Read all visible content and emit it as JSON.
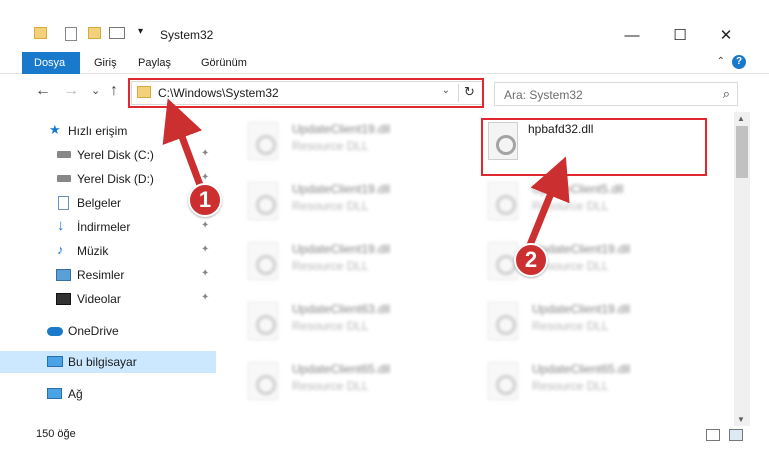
{
  "window": {
    "title": "System32",
    "minimize": "—",
    "maximize": "☐",
    "close": "✕"
  },
  "ribbon": {
    "tabs": [
      "Dosya",
      "Giriş",
      "Paylaş",
      "Görünüm"
    ],
    "help": "?",
    "collapse": "⌃"
  },
  "nav": {
    "back": "←",
    "forward": "→",
    "recent": "⌄",
    "up": "↑",
    "address": "C:\\Windows\\System32",
    "address_dropdown": "⌄",
    "refresh": "↻",
    "search_placeholder": "Ara: System32",
    "search_icon": "⌕"
  },
  "sidebar": {
    "items": [
      {
        "label": "Hızlı erişim",
        "icon": "star-icon",
        "pinned": false
      },
      {
        "label": "Yerel Disk (C:)",
        "icon": "drive-icon",
        "pinned": true
      },
      {
        "label": "Yerel Disk (D:)",
        "icon": "drive-icon",
        "pinned": true
      },
      {
        "label": "Belgeler",
        "icon": "documents-icon",
        "pinned": true
      },
      {
        "label": "İndirmeler",
        "icon": "download-icon",
        "pinned": true
      },
      {
        "label": "Müzik",
        "icon": "music-icon",
        "pinned": true
      },
      {
        "label": "Resimler",
        "icon": "pictures-icon",
        "pinned": true
      },
      {
        "label": "Videolar",
        "icon": "videos-icon",
        "pinned": true
      },
      {
        "label": "OneDrive",
        "icon": "cloud-icon",
        "pinned": false
      },
      {
        "label": "Bu bilgisayar",
        "icon": "computer-icon",
        "pinned": false
      },
      {
        "label": "Ağ",
        "icon": "network-icon",
        "pinned": false
      }
    ],
    "pin_glyph": "📌"
  },
  "files": {
    "left_column": [
      {
        "name": "UpdateClient19.dll",
        "type": "Resource DLL"
      },
      {
        "name": "UpdateClient19.dll",
        "type": "Resource DLL"
      },
      {
        "name": "UpdateClient19.dll",
        "type": "Resource DLL"
      },
      {
        "name": "UpdateClient63.dll",
        "type": "Resource DLL"
      },
      {
        "name": "UpdateClient65.dll",
        "type": "Resource DLL"
      }
    ],
    "right_column": [
      {
        "name": "hpbafd32.dll",
        "type": "",
        "highlighted": true
      },
      {
        "name": "UpdateClient5.dll",
        "type": "Resource DLL"
      },
      {
        "name": "UpdateClient19.dll",
        "type": "Resource DLL"
      },
      {
        "name": "UpdateClient19.dll",
        "type": "Resource DLL"
      },
      {
        "name": "UpdateClient65.dll",
        "type": "Resource DLL"
      }
    ]
  },
  "status": {
    "item_count": "150 öğe"
  },
  "callouts": {
    "one": "1",
    "two": "2"
  },
  "colors": {
    "accent": "#1979ca",
    "highlight": "#e0282e",
    "callout": "#cc2f2f",
    "selected": "#cce8ff"
  }
}
